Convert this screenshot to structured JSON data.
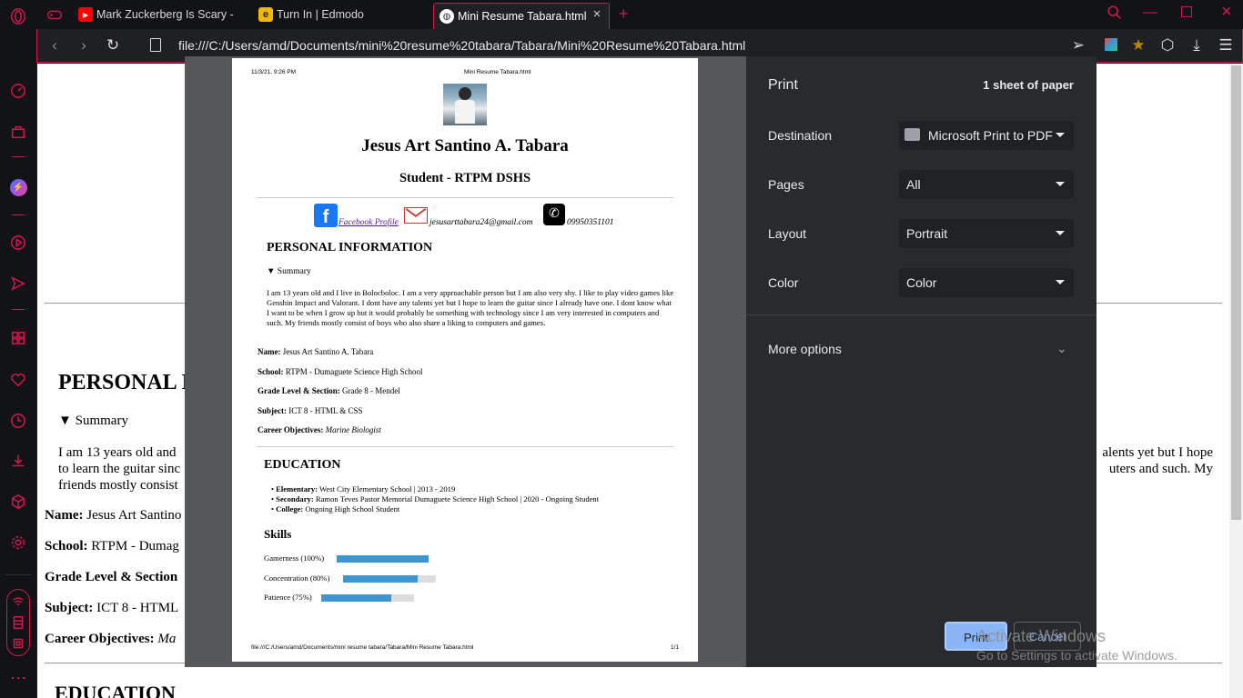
{
  "browser": {
    "tabs": [
      {
        "title": "Mark Zuckerberg Is Scary -"
      },
      {
        "title": "Turn In | Edmodo"
      },
      {
        "title": "Mini Resume Tabara.html",
        "active": true
      }
    ],
    "url": "file:///C:/Users/amd/Documents/mini%20resume%20tabara/Tabara/Mini%20Resume%20Tabara.html"
  },
  "background_page": {
    "section_personal": "PERSONAL I",
    "summary_label": "Summary",
    "summary_left": "I am 13 years old and",
    "summary_left2": "to learn the guitar sinc",
    "summary_left3": "friends mostly consist",
    "summary_right": "alents yet but I hope",
    "summary_right2": "uters and such. My",
    "name_label": "Name:",
    "name_value": "Jesus Art Santino",
    "school_label": "School:",
    "school_value": "RTPM - Dumag",
    "grade_label": "Grade Level & Section",
    "subject_label": "Subject:",
    "subject_value": "ICT 8 - HTML",
    "career_label": "Career Objectives:",
    "career_value": "Ma",
    "section_education": "EDUCATION"
  },
  "sheet": {
    "header_date": "11/3/21, 9:26 PM",
    "header_title": "Mini Resume Tabara.html",
    "name": "Jesus Art Santino A. Tabara",
    "role": "Student - RTPM DSHS",
    "facebook_link": "Facebook Profile",
    "email": "jesusarttabara24@gmail.com",
    "phone": "09950351101",
    "personal_heading": "PERSONAL INFORMATION",
    "summary_label": "Summary",
    "summary_text": "I am 13 years old and I live in Bolocboloc. I am a very approachable person but I am also very shy. I like to play video games like Genshin Impact and Valorant. I dont have any talents yet but I hope to learn the guitar since I already have one. I dont know what I want to be when I grow up but it would probably be something with technology since I am very interested in computers and such. My friends mostly consist of boys who also share a liking to computers and games.",
    "fields": [
      {
        "label": "Name:",
        "value": "Jesus Art Santino A. Tabara"
      },
      {
        "label": "School:",
        "value": "RTPM - Dumaguete Science High School"
      },
      {
        "label": "Grade Level & Section:",
        "value": "Grade 8 - Mendel"
      },
      {
        "label": "Subject:",
        "value": "ICT 8 - HTML & CSS"
      },
      {
        "label": "Career Objectives:",
        "value": "Marine Biologist"
      }
    ],
    "education_heading": "EDUCATION",
    "education": [
      {
        "label": "Elementary:",
        "value": "West City Elementary School | 2013 - 2019"
      },
      {
        "label": "Secondary:",
        "value": "Ramon Teves Pastor Memorial Dumaguete Science High School | 2020 - Ongoing Student"
      },
      {
        "label": "College:",
        "value": "Ongoing High School Student"
      }
    ],
    "skills_heading": "Skills",
    "skills": [
      {
        "label": "Gamerness (100%)",
        "level": 1.0
      },
      {
        "label": "Concentration (80%)",
        "level": 0.8
      },
      {
        "label": "Patience (75%)",
        "level": 0.75
      }
    ],
    "footer_path": "file:///C:/Users/amd/Documents/mini resume tabara/Tabara/Mini Resume Tabara.html",
    "footer_page": "1/1"
  },
  "print": {
    "title": "Print",
    "sheets": "1 sheet of paper",
    "destination_label": "Destination",
    "destination_value": "Microsoft Print to PDF",
    "pages_label": "Pages",
    "pages_value": "All",
    "layout_label": "Layout",
    "layout_value": "Portrait",
    "color_label": "Color",
    "color_value": "Color",
    "more_options": "More options",
    "print_button": "Print",
    "cancel_button": "Cancel"
  },
  "watermark": {
    "line1": "Activate Windows",
    "line2": "Go to Settings to activate Windows."
  }
}
